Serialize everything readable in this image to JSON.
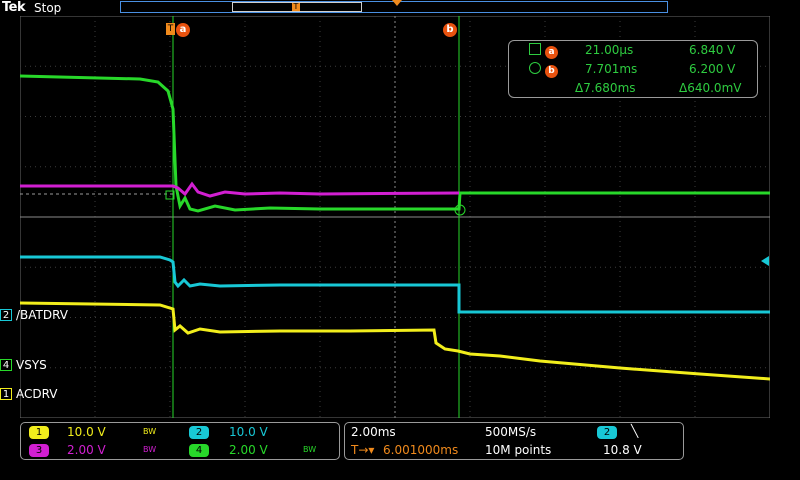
{
  "header": {
    "brand": "Tek",
    "run_state": "Stop"
  },
  "colors": {
    "ch1": "#f2ee1c",
    "ch2": "#18c8d6",
    "ch3": "#d21fd2",
    "ch4": "#28d82a",
    "cursor_label": "#e8520f",
    "trigger": "#f08a1c",
    "readout": "#2ecc40"
  },
  "channel_markers": [
    {
      "num": "2",
      "name": "/BATDRV",
      "color": "#18c8d6"
    },
    {
      "num": "4",
      "name": "VSYS",
      "color": "#28d82a"
    },
    {
      "num": "1",
      "name": "ACDRV",
      "color": "#f2ee1c"
    }
  ],
  "cursors": {
    "a": {
      "trig_letter": "T",
      "label": "a"
    },
    "b": {
      "label": "b"
    },
    "readout": {
      "row_a": {
        "time": "21.00µs",
        "value": "6.840 V"
      },
      "row_b": {
        "time": "7.701ms",
        "value": "6.200 V"
      },
      "delta": {
        "time": "Δ7.680ms",
        "value": "Δ640.0mV"
      }
    }
  },
  "status": {
    "ch1": {
      "num": "1",
      "scale": "10.0 V",
      "bw": "BW"
    },
    "ch2": {
      "num": "2",
      "scale": "10.0 V"
    },
    "ch3": {
      "num": "3",
      "scale": "2.00 V",
      "bw": "BW"
    },
    "ch4": {
      "num": "4",
      "scale": "2.00 V",
      "bw": "BW"
    },
    "timebase": "2.00ms",
    "sample_rate": "500MS/s",
    "trigger_delay": "6.001000ms",
    "record_length": "10M points",
    "trigger_source": "2",
    "trigger_slope": "╲",
    "trigger_level": "10.8 V"
  },
  "icons": [
    "trigger-marker-icon",
    "cursor-a-label-icon",
    "cursor-b-label-icon",
    "trigger-level-arrow-icon"
  ]
}
